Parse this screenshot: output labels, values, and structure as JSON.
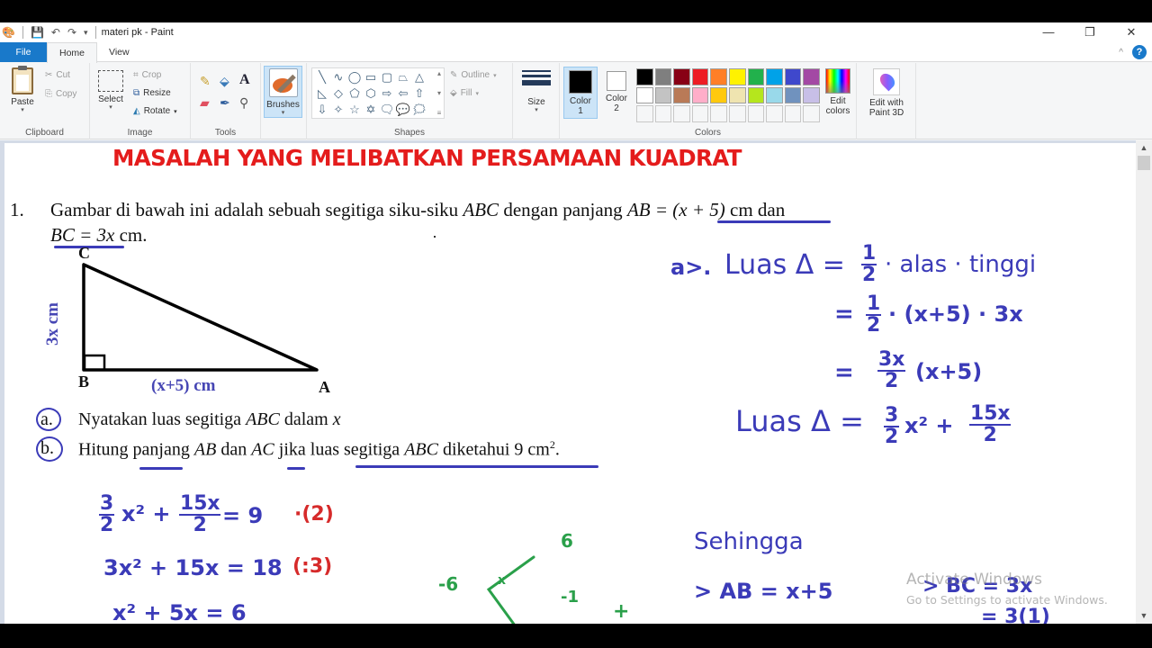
{
  "window": {
    "title": "materi pk - Paint",
    "controls": [
      "—",
      "❐",
      "✕"
    ]
  },
  "quick_access": {
    "app_icon": "paint-icon",
    "save_icon": "save-icon",
    "undo_icon": "undo-icon",
    "redo_icon": "redo-icon",
    "customize_icon": "chevron-down-icon"
  },
  "tabs": [
    {
      "label": "File",
      "active": false
    },
    {
      "label": "Home",
      "active": true
    },
    {
      "label": "View",
      "active": false
    }
  ],
  "help_label": "?",
  "collapse_glyph": "^",
  "ribbon": {
    "clipboard": {
      "group_label": "Clipboard",
      "paste": "Paste",
      "cut": "Cut",
      "copy": "Copy"
    },
    "image": {
      "group_label": "Image",
      "select": "Select",
      "crop": "Crop",
      "resize": "Resize",
      "rotate": "Rotate"
    },
    "tools": {
      "group_label": "Tools",
      "items": [
        "pencil-icon",
        "fill-icon",
        "text-icon",
        "eraser-icon",
        "color-picker-icon",
        "magnifier-icon"
      ]
    },
    "brushes": {
      "label": "Brushes"
    },
    "shapes": {
      "group_label": "Shapes",
      "outline": "Outline",
      "fill": "Fill",
      "glyphs": [
        "╲",
        "∿",
        "◯",
        "▭",
        "▢",
        "⏢",
        "△",
        "◺",
        "◇",
        "⬠",
        "⬡",
        "⇨",
        "⇦",
        "⇧",
        "⇩",
        "✧",
        "☆",
        "✡",
        "🗨",
        "💬",
        "🗯"
      ]
    },
    "size": {
      "label": "Size"
    },
    "colors": {
      "group_label": "Colors",
      "color1_label": "Color",
      "color1_num": "1",
      "color2_label": "Color",
      "color2_num": "2",
      "color1": "#000000",
      "color2": "#ffffff",
      "palette_row1": [
        "#000000",
        "#7f7f7f",
        "#880015",
        "#ed1c24",
        "#ff7f27",
        "#fff200",
        "#22b14c",
        "#00a2e8",
        "#3f48cc",
        "#a349a4"
      ],
      "palette_row2": [
        "#ffffff",
        "#c3c3c3",
        "#b97a57",
        "#ffaec9",
        "#ffc90e",
        "#efe4b0",
        "#b5e61d",
        "#99d9ea",
        "#7092be",
        "#c8bfe7"
      ],
      "palette_row3_empty": 10,
      "edit_colors_1": "Edit",
      "edit_colors_2": "colors"
    },
    "paint3d": {
      "line1": "Edit with",
      "line2": "Paint 3D"
    }
  },
  "document": {
    "heading": "MASALAH YANG MELIBATKAN PERSAMAAN KUADRAT",
    "q_number": "1.",
    "q_line1_a": "Gambar di bawah ini adalah sebuah segitiga siku-siku ",
    "q_line1_abc": "ABC",
    "q_line1_b": " dengan panjang ",
    "q_line1_ab": "AB = (x + 5)",
    "q_line1_c": " cm dan",
    "q_line2_bc": "BC = 3x",
    "q_line2_d": " cm.",
    "triangle": {
      "vertex_c": "C",
      "vertex_b": "B",
      "vertex_a": "A",
      "side_bc": "3x cm",
      "side_ab": "(x+5) cm"
    },
    "part_a_label": "a.",
    "part_a_text": "Nyatakan luas segitiga ",
    "part_a_abc": "ABC",
    "part_a_tail": " dalam ",
    "part_a_x": "x",
    "part_b_label": "b.",
    "part_b_1": "Hitung panjang ",
    "part_b_ab": "AB",
    "part_b_2": " dan ",
    "part_b_ac": "AC",
    "part_b_3": " jika luas segitiga ",
    "part_b_abc": "ABC",
    "part_b_4": " diketahui 9 cm",
    "part_b_sup": "2",
    "part_b_end": "."
  },
  "handwriting": {
    "a_prefix": "a>.",
    "a_line1_lhs": "Luas Δ =",
    "a_line1_rhs": "· alas · tinggi",
    "frac_1": "1",
    "frac_2": "2",
    "a_line2": "· (x+5) · 3x",
    "eq": "=",
    "a_line3_num": "3x",
    "a_line3_rest": "(x+5)",
    "a_line4_lhs": "Luas Δ =",
    "a_line4_n1": "3",
    "a_line4_x2": "x²  +",
    "a_line4_n2": "15x",
    "b_line1_x2": "x² +",
    "b_line1_rhs": "=  9",
    "b_line1_note": "·(2)",
    "b_line2": "3x² + 15x = 18",
    "b_line2_note": "(:3)",
    "b_line3": "x²  +  5x  =  6",
    "factor_left": "-6",
    "factor_top": "6",
    "factor_mid": "x",
    "factor_bottom": "-1",
    "factor_plus": "+",
    "sehingga": "Sehingga",
    "ab_result": "> AB = x+5",
    "bc_result": "> BC = 3x",
    "bc_sub": "= 3(1)"
  },
  "watermark": {
    "line1": "Activate Windows",
    "line2": "Go to Settings to activate Windows."
  }
}
